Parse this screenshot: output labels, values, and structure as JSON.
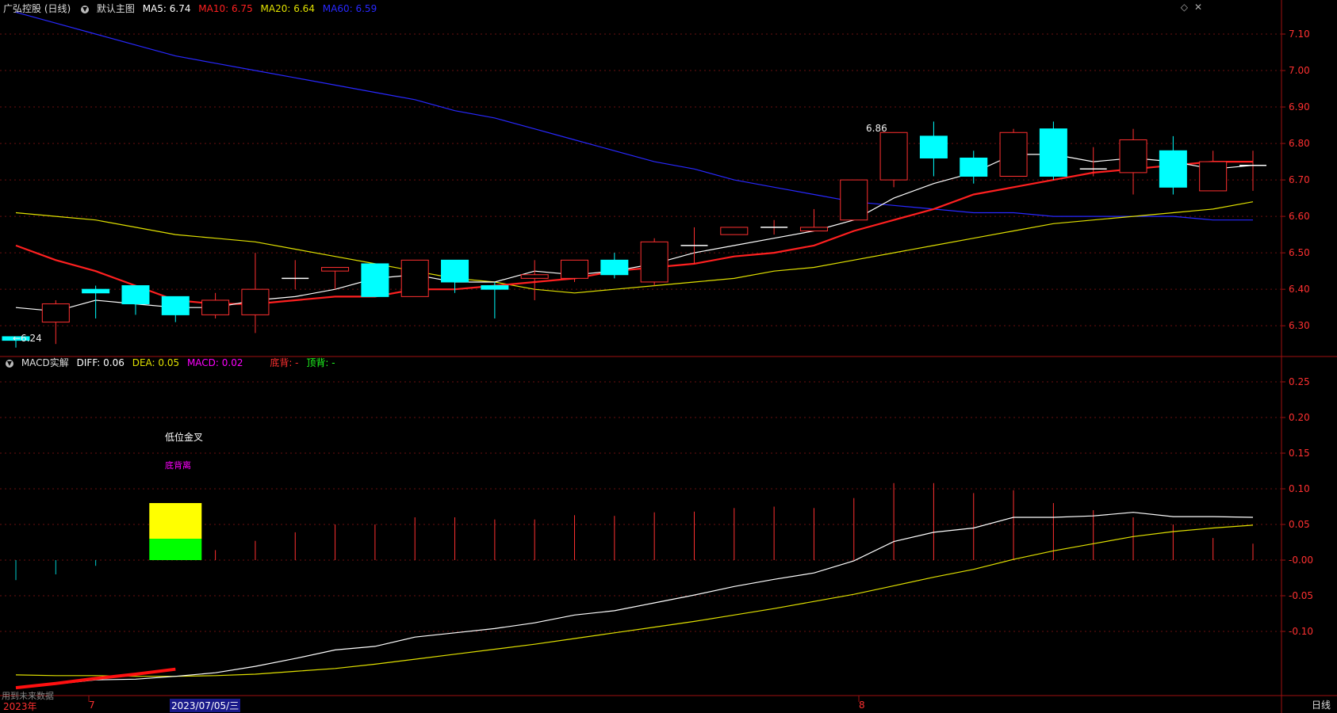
{
  "header": {
    "stock_name": "广弘控股 (日线)",
    "main_chart_label": "默认主图",
    "ma5_label": "MA5: 6.74",
    "ma10_label": "MA10: 6.75",
    "ma20_label": "MA20: 6.64",
    "ma60_label": "MA60: 6.59",
    "ma5_color": "#ffffff",
    "ma10_color": "#ff2020",
    "ma20_color": "#e0e000",
    "ma60_color": "#2828ff"
  },
  "macd_header": {
    "title": "MACD实解",
    "diff_label": "DIFF: 0.06",
    "dea_label": "DEA: 0.05",
    "macd_label": "MACD: 0.02",
    "bottom_div_label": "底背: -",
    "top_div_label": "顶背: -"
  },
  "annotations": {
    "golden_cross": "低位金叉",
    "bottom_divergence": "底背离",
    "high_marker": "6.86",
    "low_marker": "←6.24",
    "footnote": "用到未来数据"
  },
  "x_axis": {
    "labels": [
      "2023年",
      "7",
      "2023/07/05/三",
      "8"
    ]
  },
  "period_button": "日线",
  "chart_data": [
    {
      "type": "candlestick",
      "ylim": [
        6.22,
        7.15
      ],
      "yticks": [
        "7.10",
        "7.00",
        "6.90",
        "6.80",
        "6.70",
        "6.60",
        "6.50",
        "6.40",
        "6.30"
      ],
      "candles": [
        {
          "o": 6.27,
          "h": 6.27,
          "l": 6.24,
          "c": 6.26
        },
        {
          "o": 6.31,
          "h": 6.37,
          "l": 6.25,
          "c": 6.36
        },
        {
          "o": 6.4,
          "h": 6.41,
          "l": 6.32,
          "c": 6.39
        },
        {
          "o": 6.41,
          "h": 6.41,
          "l": 6.33,
          "c": 6.36
        },
        {
          "o": 6.38,
          "h": 6.38,
          "l": 6.31,
          "c": 6.33
        },
        {
          "o": 6.33,
          "h": 6.39,
          "l": 6.32,
          "c": 6.37
        },
        {
          "o": 6.33,
          "h": 6.5,
          "l": 6.28,
          "c": 6.4
        },
        {
          "o": 6.43,
          "h": 6.48,
          "l": 6.4,
          "c": 6.43
        },
        {
          "o": 6.45,
          "h": 6.46,
          "l": 6.4,
          "c": 6.46
        },
        {
          "o": 6.47,
          "h": 6.47,
          "l": 6.38,
          "c": 6.38
        },
        {
          "o": 6.38,
          "h": 6.48,
          "l": 6.38,
          "c": 6.48
        },
        {
          "o": 6.48,
          "h": 6.48,
          "l": 6.39,
          "c": 6.42
        },
        {
          "o": 6.41,
          "h": 6.42,
          "l": 6.32,
          "c": 6.4
        },
        {
          "o": 6.43,
          "h": 6.48,
          "l": 6.37,
          "c": 6.44
        },
        {
          "o": 6.43,
          "h": 6.48,
          "l": 6.42,
          "c": 6.48
        },
        {
          "o": 6.48,
          "h": 6.5,
          "l": 6.43,
          "c": 6.44
        },
        {
          "o": 6.42,
          "h": 6.54,
          "l": 6.41,
          "c": 6.53
        },
        {
          "o": 6.52,
          "h": 6.57,
          "l": 6.47,
          "c": 6.52
        },
        {
          "o": 6.55,
          "h": 6.57,
          "l": 6.55,
          "c": 6.57
        },
        {
          "o": 6.57,
          "h": 6.59,
          "l": 6.55,
          "c": 6.57
        },
        {
          "o": 6.56,
          "h": 6.62,
          "l": 6.56,
          "c": 6.57
        },
        {
          "o": 6.59,
          "h": 6.7,
          "l": 6.59,
          "c": 6.7
        },
        {
          "o": 6.7,
          "h": 6.83,
          "l": 6.68,
          "c": 6.83
        },
        {
          "o": 6.82,
          "h": 6.86,
          "l": 6.71,
          "c": 6.76
        },
        {
          "o": 6.76,
          "h": 6.78,
          "l": 6.69,
          "c": 6.71
        },
        {
          "o": 6.71,
          "h": 6.84,
          "l": 6.71,
          "c": 6.83
        },
        {
          "o": 6.84,
          "h": 6.86,
          "l": 6.7,
          "c": 6.71
        },
        {
          "o": 6.73,
          "h": 6.79,
          "l": 6.71,
          "c": 6.73
        },
        {
          "o": 6.72,
          "h": 6.84,
          "l": 6.66,
          "c": 6.81
        },
        {
          "o": 6.78,
          "h": 6.82,
          "l": 6.66,
          "c": 6.68
        },
        {
          "o": 6.67,
          "h": 6.78,
          "l": 6.67,
          "c": 6.75
        },
        {
          "o": 6.74,
          "h": 6.78,
          "l": 6.67,
          "c": 6.74
        }
      ],
      "ma5": [
        6.35,
        6.34,
        6.37,
        6.36,
        6.35,
        6.35,
        6.37,
        6.38,
        6.4,
        6.43,
        6.44,
        6.42,
        6.42,
        6.45,
        6.44,
        6.45,
        6.47,
        6.5,
        6.52,
        6.54,
        6.56,
        6.59,
        6.65,
        6.69,
        6.72,
        6.77,
        6.77,
        6.75,
        6.76,
        6.75,
        6.73,
        6.74
      ],
      "ma10": [
        6.52,
        6.48,
        6.45,
        6.41,
        6.37,
        6.36,
        6.36,
        6.37,
        6.38,
        6.38,
        6.4,
        6.4,
        6.41,
        6.42,
        6.43,
        6.45,
        6.46,
        6.47,
        6.49,
        6.5,
        6.52,
        6.56,
        6.59,
        6.62,
        6.66,
        6.68,
        6.7,
        6.72,
        6.73,
        6.74,
        6.75,
        6.75
      ],
      "ma20": [
        6.61,
        6.6,
        6.59,
        6.57,
        6.55,
        6.54,
        6.53,
        6.51,
        6.49,
        6.47,
        6.45,
        6.43,
        6.42,
        6.4,
        6.39,
        6.4,
        6.41,
        6.42,
        6.43,
        6.45,
        6.46,
        6.48,
        6.5,
        6.52,
        6.54,
        6.56,
        6.58,
        6.59,
        6.6,
        6.61,
        6.62,
        6.64
      ],
      "ma60": [
        7.16,
        7.13,
        7.1,
        7.07,
        7.04,
        7.02,
        7.0,
        6.98,
        6.96,
        6.94,
        6.92,
        6.89,
        6.87,
        6.84,
        6.81,
        6.78,
        6.75,
        6.73,
        6.7,
        6.68,
        6.66,
        6.64,
        6.63,
        6.62,
        6.61,
        6.61,
        6.6,
        6.6,
        6.6,
        6.6,
        6.59,
        6.59
      ]
    },
    {
      "type": "macd",
      "ylim": [
        -0.19,
        0.27
      ],
      "yticks": [
        "0.25",
        "0.20",
        "0.15",
        "0.10",
        "0.05",
        "-0.00",
        "-0.05",
        "-0.10"
      ],
      "macd": [
        -0.028,
        -0.02,
        -0.008,
        0,
        0.08,
        0.014,
        0.027,
        0.039,
        0.05,
        0.05,
        0.06,
        0.06,
        0.057,
        0.057,
        0.063,
        0.062,
        0.067,
        0.068,
        0.073,
        0.075,
        0.073,
        0.087,
        0.108,
        0.108,
        0.094,
        0.098,
        0.08,
        0.07,
        0.06,
        0.05,
        0.031,
        0.023
      ],
      "diff": [
        -0.178,
        -0.174,
        -0.168,
        -0.167,
        -0.163,
        -0.158,
        -0.149,
        -0.138,
        -0.126,
        -0.121,
        -0.108,
        -0.102,
        -0.096,
        -0.088,
        -0.077,
        -0.071,
        -0.06,
        -0.049,
        -0.037,
        -0.027,
        -0.018,
        -0.001,
        0.026,
        0.039,
        0.045,
        0.06,
        0.06,
        0.062,
        0.067,
        0.061,
        0.061,
        0.06
      ],
      "dea": [
        -0.161,
        -0.162,
        -0.162,
        -0.163,
        -0.163,
        -0.162,
        -0.16,
        -0.156,
        -0.152,
        -0.146,
        -0.139,
        -0.132,
        -0.125,
        -0.118,
        -0.11,
        -0.102,
        -0.094,
        -0.086,
        -0.077,
        -0.068,
        -0.058,
        -0.048,
        -0.036,
        -0.024,
        -0.013,
        0.001,
        0.013,
        0.023,
        0.033,
        0.04,
        0.045,
        0.049
      ]
    }
  ]
}
